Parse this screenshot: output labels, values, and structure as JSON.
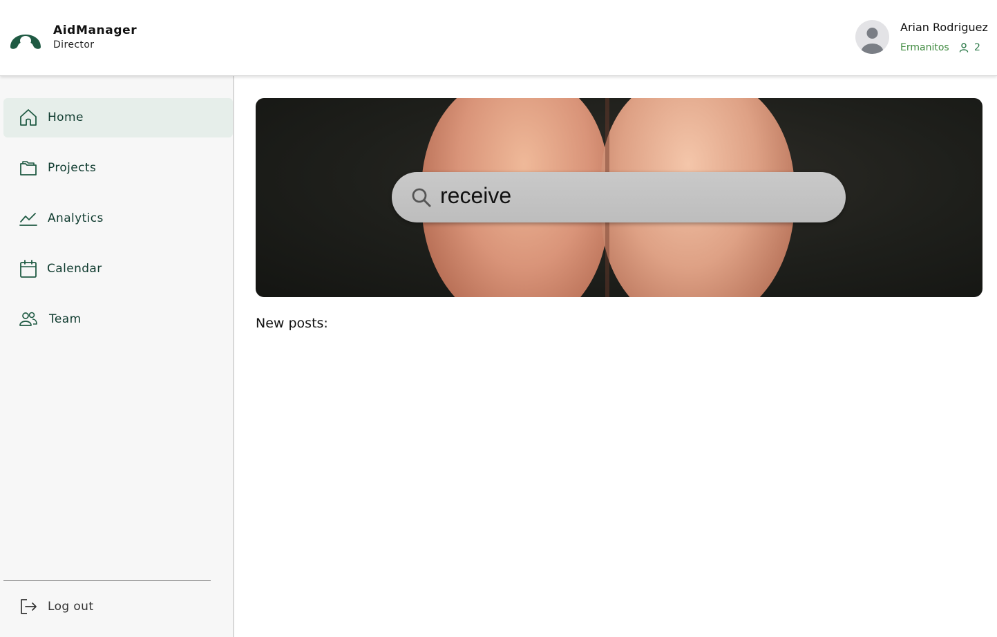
{
  "header": {
    "brand_title": "AidManager",
    "brand_subtitle": "Director",
    "logo_icon": "aidmanager-logo-icon",
    "user": {
      "name": "Arian Rodriguez",
      "organization": "Ermanitos",
      "member_count": "2",
      "avatar_icon": "user-avatar-icon",
      "member_icon": "person-icon"
    }
  },
  "sidebar": {
    "items": [
      {
        "label": "Home",
        "icon": "home-icon",
        "active": true
      },
      {
        "label": "Projects",
        "icon": "folder-icon",
        "active": false
      },
      {
        "label": "Analytics",
        "icon": "chart-line-icon",
        "active": false
      },
      {
        "label": "Calendar",
        "icon": "calendar-icon",
        "active": false
      },
      {
        "label": "Team",
        "icon": "team-icon",
        "active": false
      }
    ],
    "logout": {
      "label": "Log out",
      "icon": "logout-icon"
    }
  },
  "main": {
    "hero": {
      "search_text": "receive",
      "search_icon": "search-icon"
    },
    "new_posts_title": "New posts:"
  },
  "colors": {
    "brand_green": "#1f5a43",
    "accent_green": "#3f8a3f",
    "active_bg": "#e6eeea",
    "sidebar_bg": "#f7f7f7"
  }
}
